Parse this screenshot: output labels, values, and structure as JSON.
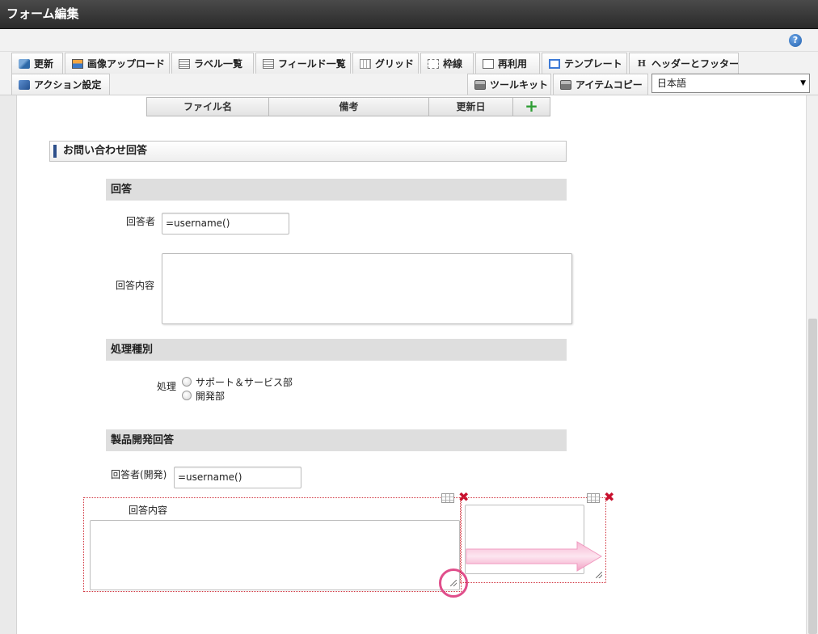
{
  "window": {
    "title": "フォーム編集"
  },
  "toolbar": {
    "row1": [
      {
        "label": "更新",
        "icon": "update-icon"
      },
      {
        "label": "画像アップロード",
        "icon": "image-upload-icon"
      },
      {
        "label": "ラベル一覧",
        "icon": "label-list-icon"
      },
      {
        "label": "フィールド一覧",
        "icon": "field-list-icon"
      },
      {
        "label": "グリッド",
        "icon": "grid-icon"
      },
      {
        "label": "枠線",
        "icon": "border-icon"
      },
      {
        "label": "再利用",
        "icon": "reuse-icon"
      },
      {
        "label": "テンプレート",
        "icon": "template-icon"
      },
      {
        "label": "ヘッダーとフッター",
        "icon": "header-footer-icon"
      }
    ],
    "row2_left": [
      {
        "label": "アクション設定",
        "icon": "action-settings-icon"
      }
    ],
    "row2_right": [
      {
        "label": "ツールキット",
        "icon": "toolkit-icon"
      },
      {
        "label": "アイテムコピー",
        "icon": "item-copy-icon"
      }
    ],
    "language": "日本語"
  },
  "file_table": {
    "columns": [
      "ファイル名",
      "備考",
      "更新日"
    ],
    "add_icon": "plus-icon"
  },
  "form": {
    "section_title": "お問い合わせ回答",
    "answer": {
      "title": "回答",
      "responder_label": "回答者",
      "responder_value": "=username()",
      "content_label": "回答内容"
    },
    "processing": {
      "title": "処理種別",
      "label": "処理",
      "options": [
        "サポート＆サービス部",
        "開発部"
      ]
    },
    "dev": {
      "title": "製品開発回答",
      "responder_label": "回答者(開発)",
      "responder_value": "=username()",
      "content_label": "回答内容"
    }
  },
  "colors": {
    "accent": "#2d4f8a",
    "highlight": "#e04e8b",
    "delete": "#c8102e",
    "add": "#2f9e35"
  }
}
